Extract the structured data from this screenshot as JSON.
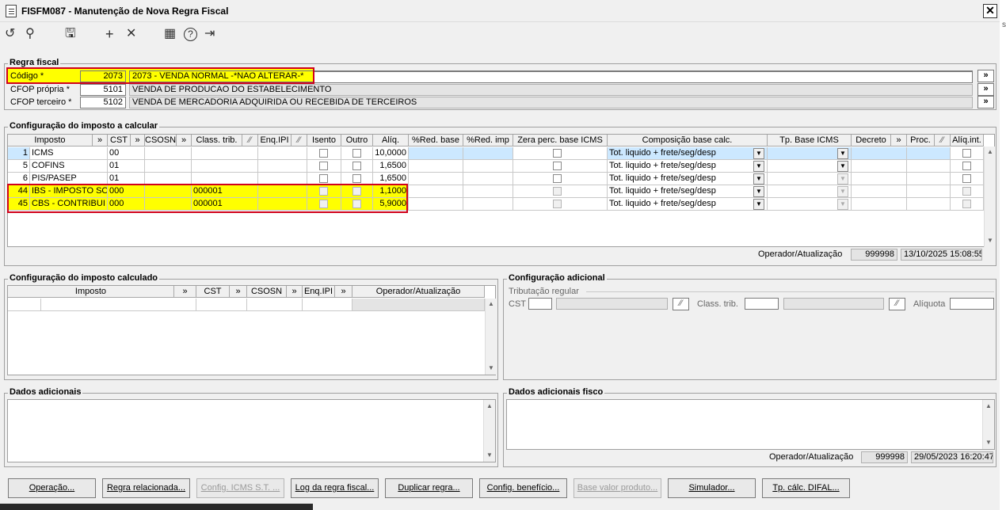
{
  "window": {
    "title": "FISFM087 - Manutenção de Nova Regra Fiscal",
    "close": "✕",
    "side_char": "s"
  },
  "toolbar": {
    "refresh": "↺",
    "search": "⚲",
    "save": "🖫",
    "add": "+",
    "cancel": "✕",
    "calendar": "▦",
    "help": "?",
    "exit": "⇥"
  },
  "regra_fiscal": {
    "title": "Regra fiscal",
    "codigo_label": "Código *",
    "codigo_value": "2073",
    "codigo_desc": "2073 - VENDA NORMAL -*NAO ALTERAR-*",
    "cfop_propria_label": "CFOP própria *",
    "cfop_propria_value": "5101",
    "cfop_propria_desc": "VENDA DE PRODUCAO DO ESTABELECIMENTO",
    "cfop_terceiro_label": "CFOP terceiro *",
    "cfop_terceiro_value": "5102",
    "cfop_terceiro_desc": "VENDA DE MERCADORIA ADQUIRIDA OU RECEBIDA DE TERCEIROS",
    "more": "»"
  },
  "imposto_calcular": {
    "title": "Configuração do imposto a calcular",
    "headers": {
      "imposto": "Imposto",
      "more": "»",
      "cst": "CST",
      "csosn": "CSOSN",
      "class_trib": "Class. trib.",
      "enq_ipi": "Enq.IPI",
      "isento": "Isento",
      "outro": "Outro",
      "aliq": "Alíq.",
      "red_base": "%Red. base",
      "red_imp": "%Red. imp",
      "zera": "Zera perc. base ICMS",
      "composicao": "Composição base calc.",
      "tp_base": "Tp. Base ICMS",
      "decreto": "Decreto",
      "proc": "Proc.",
      "aliq_int": "Alíq.int."
    },
    "rows": [
      {
        "code": "1",
        "name": "ICMS",
        "cst": "00",
        "class_trib": "",
        "aliq": "10,0000",
        "composicao": "Tot. liquido + frete/seg/desp"
      },
      {
        "code": "5",
        "name": "COFINS",
        "cst": "01",
        "class_trib": "",
        "aliq": "1,6500",
        "composicao": "Tot. liquido + frete/seg/desp"
      },
      {
        "code": "6",
        "name": "PIS/PASEP",
        "cst": "01",
        "class_trib": "",
        "aliq": "1,6500",
        "composicao": "Tot. liquido + frete/seg/desp"
      },
      {
        "code": "44",
        "name": "IBS - IMPOSTO SO",
        "cst": "000",
        "class_trib": "000001",
        "aliq": "1,1000",
        "composicao": "Tot. liquido + frete/seg/desp"
      },
      {
        "code": "45",
        "name": "CBS - CONTRIBUI",
        "cst": "000",
        "class_trib": "000001",
        "aliq": "5,9000",
        "composicao": "Tot. liquido + frete/seg/desp"
      }
    ],
    "operador_label": "Operador/Atualização",
    "operador_value": "999998",
    "operador_date": "13/10/2025 15:08:55"
  },
  "imposto_calculado": {
    "title": "Configuração do imposto calculado",
    "headers": {
      "imposto": "Imposto",
      "more": "»",
      "cst": "CST",
      "csosn": "CSOSN",
      "enq_ipi": "Enq.IPI",
      "operador": "Operador/Atualização"
    }
  },
  "config_adicional": {
    "title": "Configuração adicional",
    "sub": "Tributação regular",
    "cst_label": "CST",
    "class_label": "Class. trib.",
    "aliq_label": "Alíquota"
  },
  "dados_adicionais": {
    "title": "Dados adicionais"
  },
  "dados_fisco": {
    "title": "Dados adicionais fisco",
    "operador_label": "Operador/Atualização",
    "operador_value": "999998",
    "operador_date": "29/05/2023 16:20:47"
  },
  "buttons": {
    "operacao": "Operação...",
    "regra": "Regra relacionada...",
    "icms_st": "Config. ICMS S.T. ...",
    "log": "Log da regra fiscal...",
    "duplicar": "Duplicar regra...",
    "beneficio": "Config. benefício...",
    "base_valor": "Base valor produto...",
    "simulador": "Simulador...",
    "difal": "Tp. cálc. DIFAL..."
  },
  "colors": {
    "highlight": "#ffff00",
    "redbox": "#d0021b",
    "selected": "#cce8ff"
  }
}
